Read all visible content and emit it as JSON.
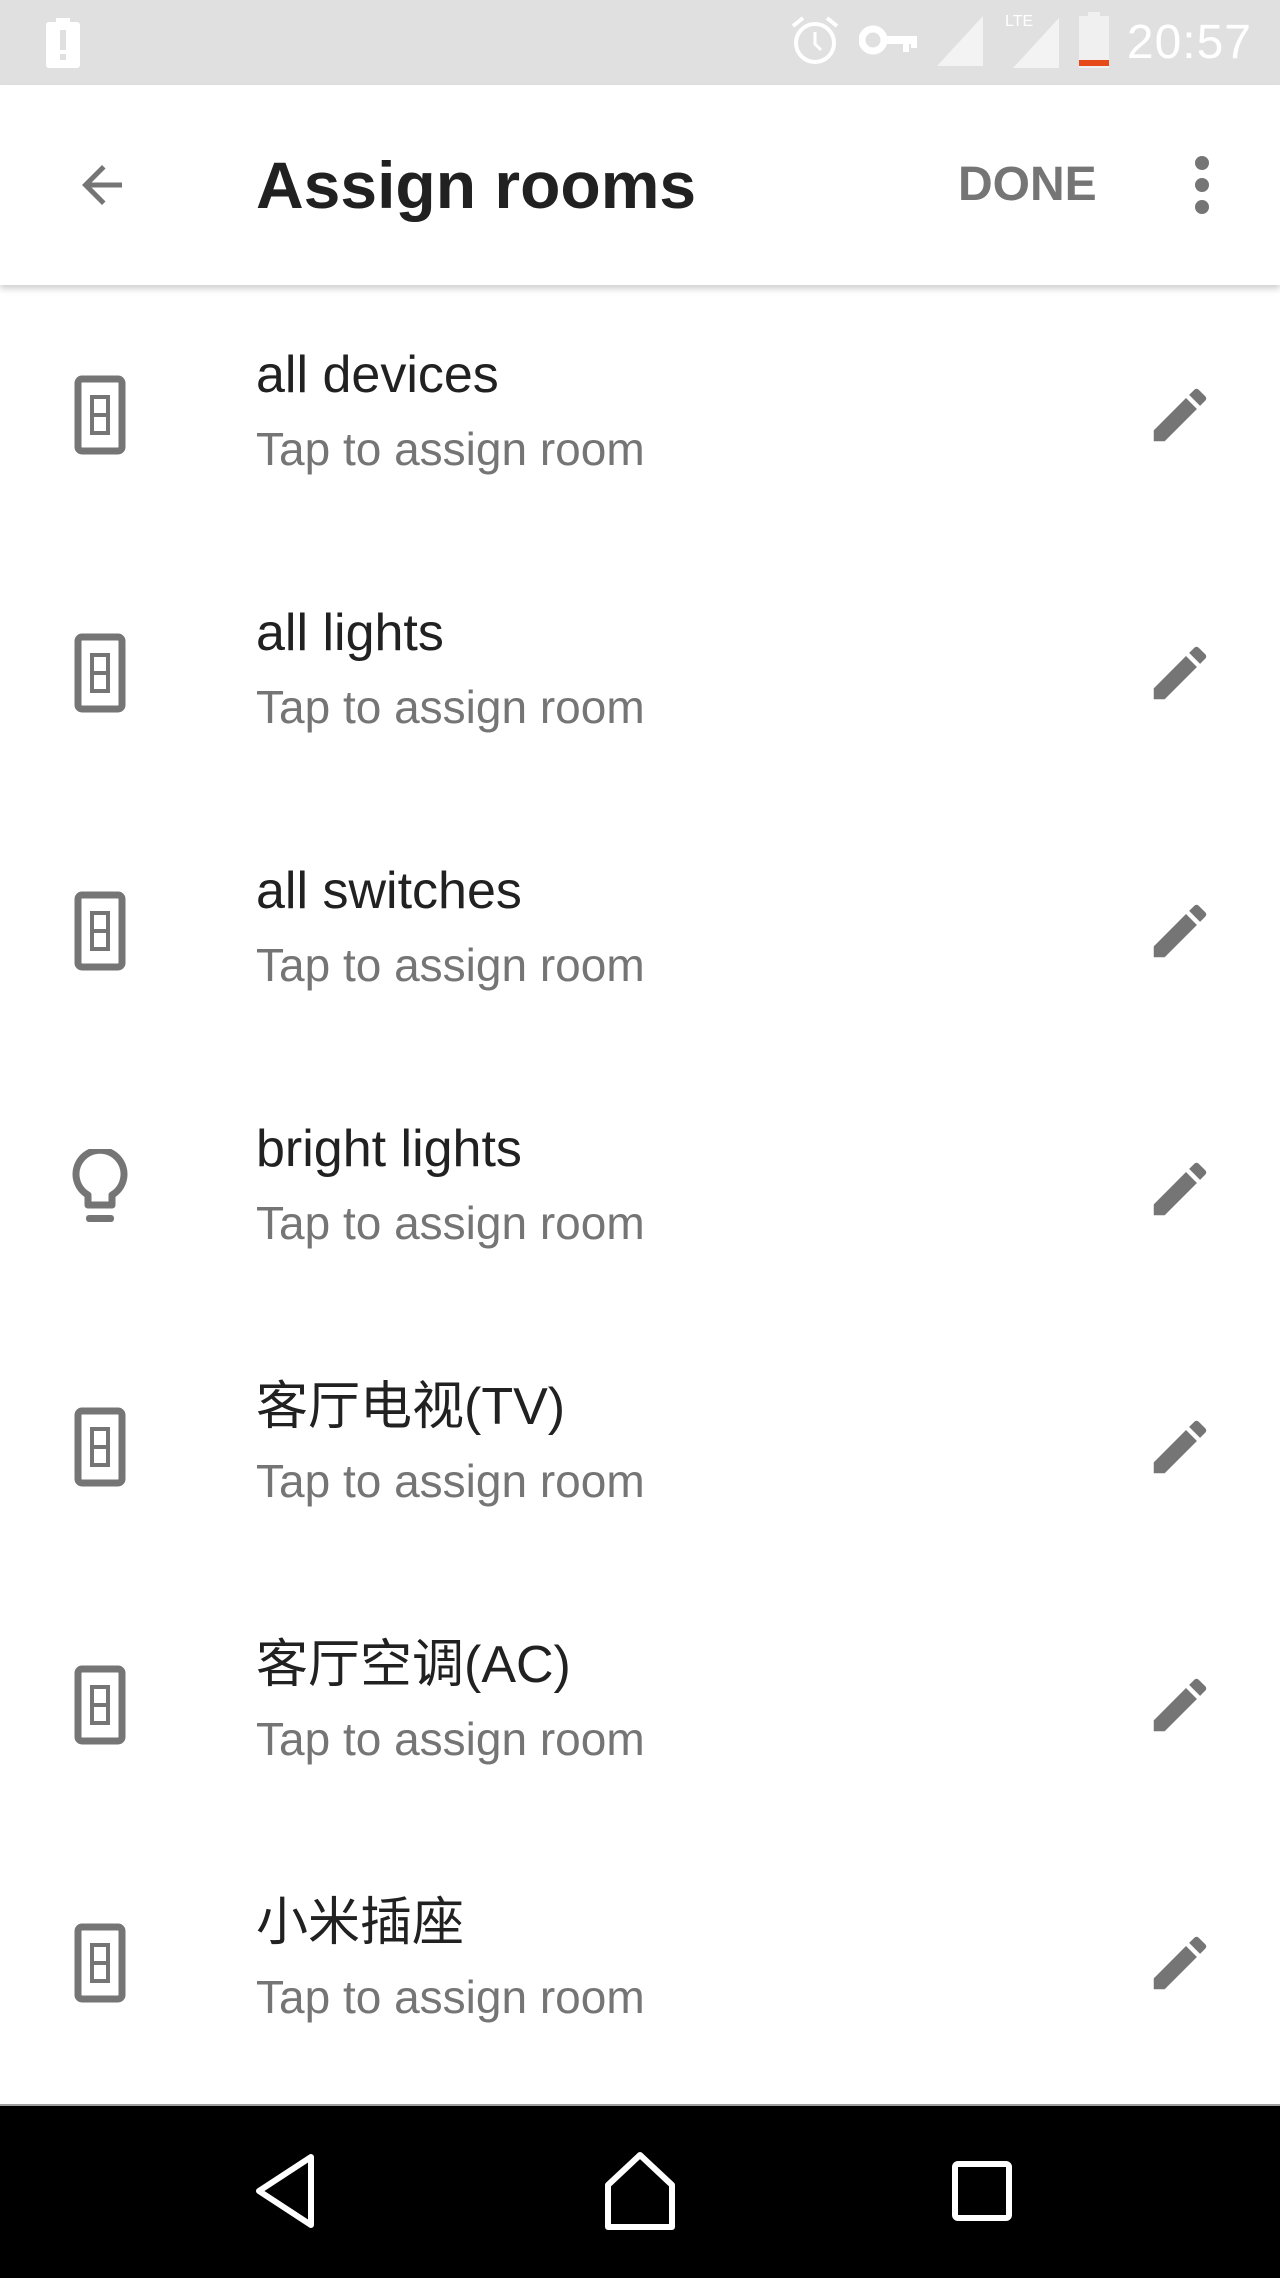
{
  "status_bar": {
    "time": "20:57",
    "network_label": "LTE",
    "battery_low_color": "#e64a19",
    "icons": [
      "battery-alert-icon",
      "alarm-icon",
      "vpn-key-icon",
      "signal-icon",
      "lte-signal-icon",
      "battery-icon"
    ]
  },
  "app_bar": {
    "title": "Assign rooms",
    "done_label": "DONE",
    "back_icon": "arrow-back-icon",
    "more_icon": "more-vert-icon"
  },
  "devices": [
    {
      "name": "all devices",
      "subtitle": "Tap to assign room",
      "icon": "switch-icon"
    },
    {
      "name": "all lights",
      "subtitle": "Tap to assign room",
      "icon": "switch-icon"
    },
    {
      "name": "all switches",
      "subtitle": "Tap to assign room",
      "icon": "switch-icon"
    },
    {
      "name": "bright lights",
      "subtitle": "Tap to assign room",
      "icon": "lightbulb-icon"
    },
    {
      "name": "客厅电视(TV)",
      "subtitle": "Tap to assign room",
      "icon": "switch-icon"
    },
    {
      "name": "客厅空调(AC)",
      "subtitle": "Tap to assign room",
      "icon": "switch-icon"
    },
    {
      "name": "小米插座",
      "subtitle": "Tap to assign room",
      "icon": "switch-icon"
    }
  ],
  "nav_bar": {
    "buttons": [
      "back",
      "home",
      "recents"
    ]
  },
  "colors": {
    "icon_gray": "#757575",
    "text_primary": "#212121",
    "text_secondary": "#757575",
    "status_bar_bg": "#e0e0e0"
  }
}
